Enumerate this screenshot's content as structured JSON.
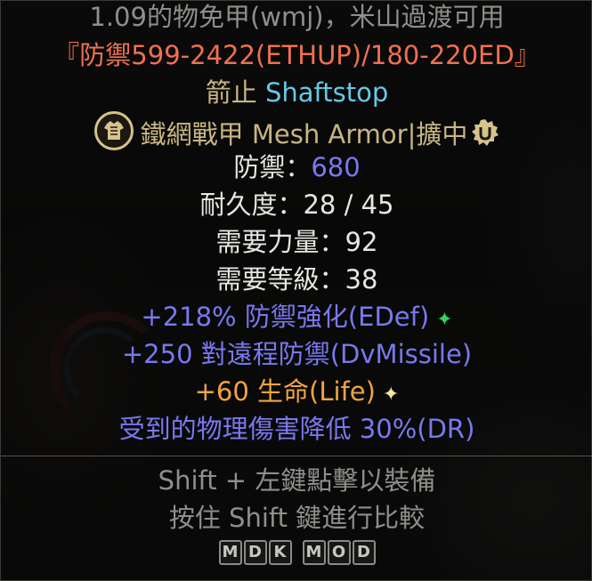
{
  "tooltip": {
    "note": "1.09的物免甲(wmj)，米山過渡可用",
    "summary": "『防禦599-2422(ETHUP)/180-220ED』",
    "item_name_zh": "箭止",
    "item_name_en": "Shaftstop",
    "base_line": "鐵網戰甲 Mesh Armor|擴中",
    "defense_label": "防禦：",
    "defense_value": "680",
    "durability": "耐久度：28 / 45",
    "req_str": "需要力量：92",
    "req_level": "需要等級：38",
    "mods": [
      "+218% 防禦強化(EDef)",
      "+250 對遠程防禦(DvMissile)",
      "+60 生命(Life)",
      "受到的物理傷害降低 30%(DR)"
    ],
    "stars": [
      "✦",
      "✦"
    ],
    "hint_equip": "Shift + 左鍵點擊以裝備",
    "hint_compare": "按住 Shift 鍵進行比較",
    "mod_tag": [
      "M",
      "D",
      "K",
      "M",
      "O",
      "D"
    ],
    "icons": {
      "armor": "armor-type-icon",
      "unique": "unique-badge-icon"
    },
    "colors": {
      "gray": "#8e8e8a",
      "white": "#e8e6e0",
      "magic_blue": "#7a78ee",
      "unique_gold": "#c8b583",
      "orange": "#f0a440",
      "summary_red": "#f07050",
      "name_cyan": "#67c8e8"
    }
  }
}
